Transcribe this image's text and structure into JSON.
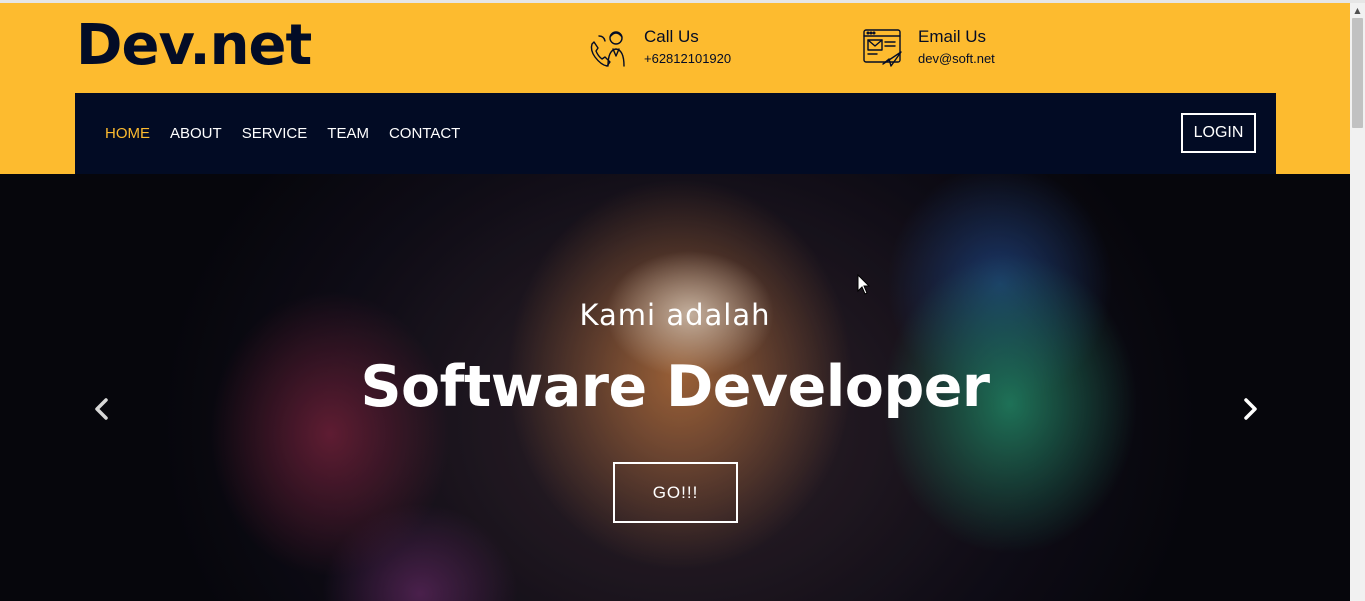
{
  "brand": {
    "name": "Dev.net"
  },
  "contacts": {
    "call": {
      "title": "Call Us",
      "value": "+62812101920",
      "icon": "phone-support-icon"
    },
    "email": {
      "title": "Email Us",
      "value": "dev@soft.net",
      "icon": "email-send-icon"
    }
  },
  "nav": {
    "items": [
      {
        "label": "HOME",
        "active": true
      },
      {
        "label": "ABOUT",
        "active": false
      },
      {
        "label": "SERVICE",
        "active": false
      },
      {
        "label": "TEAM",
        "active": false
      },
      {
        "label": "CONTACT",
        "active": false
      }
    ],
    "login_label": "LOGIN"
  },
  "hero": {
    "kicker": "Kami adalah",
    "headline": "Software Developer",
    "cta_label": "GO!!!",
    "prev_icon": "chevron-left-icon",
    "next_icon": "chevron-right-icon"
  },
  "colors": {
    "accent": "#fdbb2f",
    "navy": "#020b24",
    "brand_text": "#030c26"
  }
}
